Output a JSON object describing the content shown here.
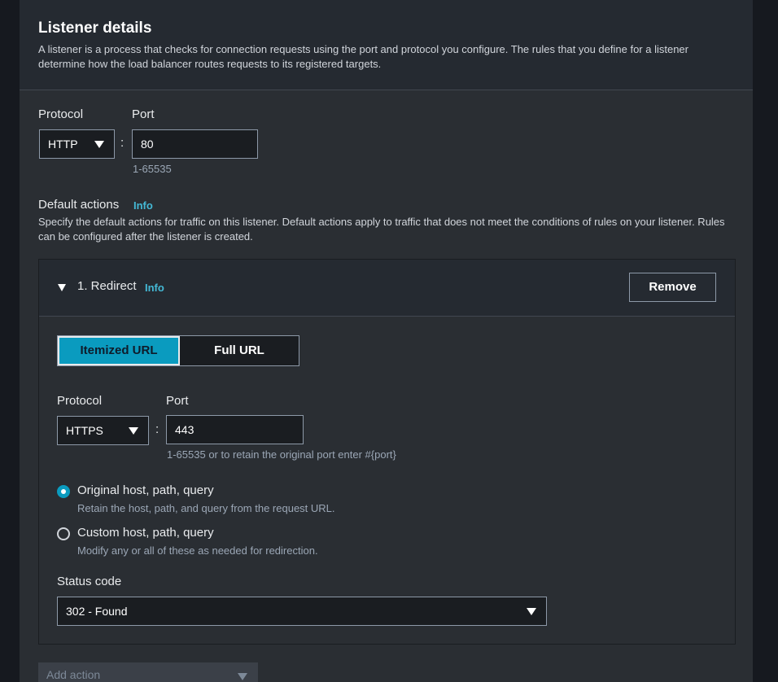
{
  "header": {
    "title": "Listener details",
    "description": "A listener is a process that checks for connection requests using the port and protocol you configure. The rules that you define for a listener determine how the load balancer routes requests to its registered targets."
  },
  "listener": {
    "protocol_label": "Protocol",
    "protocol_value": "HTTP",
    "port_label": "Port",
    "port_value": "80",
    "port_hint": "1-65535",
    "separator": ":"
  },
  "default_actions": {
    "title": "Default actions",
    "info": "Info",
    "description": "Specify the default actions for traffic on this listener. Default actions apply to traffic that does not meet the conditions of rules on your listener. Rules can be configured after the listener is created."
  },
  "action": {
    "title": "1. Redirect",
    "info": "Info",
    "remove_label": "Remove",
    "tabs": [
      "Itemized URL",
      "Full URL"
    ],
    "protocol_label": "Protocol",
    "protocol_value": "HTTPS",
    "port_label": "Port",
    "port_value": "443",
    "port_hint": "1-65535 or to retain the original port enter #{port}",
    "separator": ":",
    "options": [
      {
        "label": "Original host, path, query",
        "description": "Retain the host, path, and query from the request URL.",
        "selected": true
      },
      {
        "label": "Custom host, path, query",
        "description": "Modify any or all of these as needed for redirection.",
        "selected": false
      }
    ],
    "status_code_label": "Status code",
    "status_code_value": "302 - Found"
  },
  "add_action": {
    "placeholder": "Add action"
  },
  "colors": {
    "accent": "#0a9bbf",
    "link": "#44b9d6",
    "panel": "#2a2e33",
    "header": "#252a31"
  },
  "icons": [
    "caret-down-icon",
    "expand-triangle-icon",
    "radio-selected-icon",
    "radio-unselected-icon"
  ]
}
